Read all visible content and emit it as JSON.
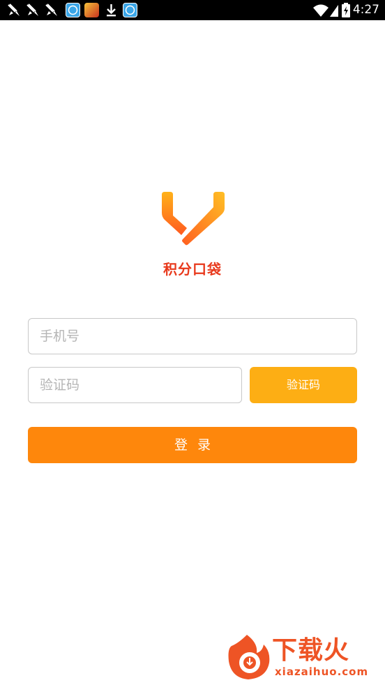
{
  "status_bar": {
    "time": "4:27",
    "notification_icons": [
      "tools-icon",
      "tools-icon",
      "tools-icon",
      "fox-browser-icon",
      "game-icon",
      "download-icon",
      "fox-browser-icon"
    ],
    "system_icons": [
      "wifi-icon",
      "signal-icon",
      "battery-charging-icon"
    ]
  },
  "app": {
    "name": "积分口袋",
    "brand_color": "#e8391c",
    "logo_gradient": [
      "#ffb21a",
      "#ff5a1f"
    ]
  },
  "form": {
    "phone_placeholder": "手机号",
    "phone_value": "",
    "code_placeholder": "验证码",
    "code_value": "",
    "code_button_label": "验证码",
    "code_button_color": "#fdae14",
    "login_button_label": "登录",
    "login_button_color": "#fe870c"
  },
  "watermark": {
    "title": "下载火",
    "url": "xiazaihuo.com",
    "color": "#ee5425"
  }
}
